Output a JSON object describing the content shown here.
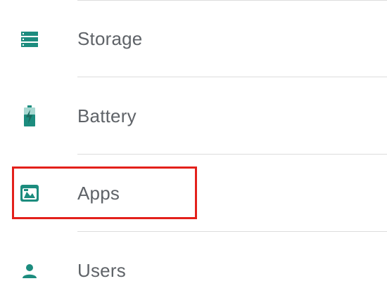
{
  "settings_list": {
    "items": [
      {
        "label": "Storage",
        "icon": "storage-icon"
      },
      {
        "label": "Battery",
        "icon": "battery-charging-icon"
      },
      {
        "label": "Apps",
        "icon": "apps-icon"
      },
      {
        "label": "Users",
        "icon": "person-icon"
      }
    ]
  },
  "colors": {
    "icon_teal": "#1c8c7e",
    "label_gray": "#5f6368",
    "divider": "#dcdcdc",
    "highlight_red": "#e3201b"
  },
  "highlight": {
    "target": "Apps"
  }
}
